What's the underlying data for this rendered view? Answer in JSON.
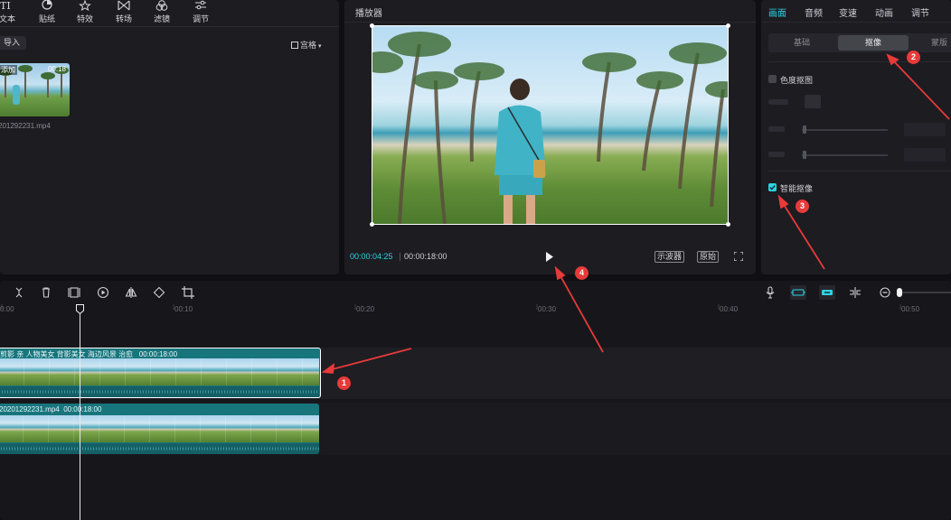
{
  "media": {
    "tools": [
      {
        "label": "文本",
        "icon": "text-icon"
      },
      {
        "label": "贴纸",
        "icon": "sticker-icon"
      },
      {
        "label": "特效",
        "icon": "effects-icon"
      },
      {
        "label": "转场",
        "icon": "transition-icon"
      },
      {
        "label": "滤镜",
        "icon": "filter-icon"
      },
      {
        "label": "调节",
        "icon": "adjust-icon"
      }
    ],
    "import_label": "导入",
    "view_label": "宫格",
    "item": {
      "added_label": "添加",
      "duration": "00:18",
      "filename": "201292231.mp4"
    }
  },
  "player": {
    "title": "播放器",
    "current_time": "00:00:04:25",
    "total_time": "00:00:18:00",
    "scope_button": "示波器",
    "original_button": "原始"
  },
  "props": {
    "tabs": [
      "画面",
      "音频",
      "变速",
      "动画",
      "调节"
    ],
    "active_tab": 0,
    "subtabs": [
      "基础",
      "抠像",
      "蒙版"
    ],
    "active_subtab": 1,
    "chroma_key_label": "色度抠图",
    "chroma_key_checked": false,
    "smart_cutout_label": "智能抠像",
    "smart_cutout_checked": true
  },
  "annotations": [
    "1",
    "2",
    "3",
    "4"
  ],
  "timeline": {
    "ruler": [
      "0:00",
      "00:10",
      "00:20",
      "00:30",
      "00:40",
      "00:50"
    ],
    "tracks": [
      {
        "label": "剪影 亲 人物美女 背影美女 海边风景 治愈",
        "duration": "00:00:18:00"
      },
      {
        "label": "20201292231.mp4",
        "duration": "00:00:18:00"
      }
    ]
  },
  "colors": {
    "accent": "#2fd2e3",
    "clip": "#17757c",
    "annotation": "#e83a3a"
  }
}
